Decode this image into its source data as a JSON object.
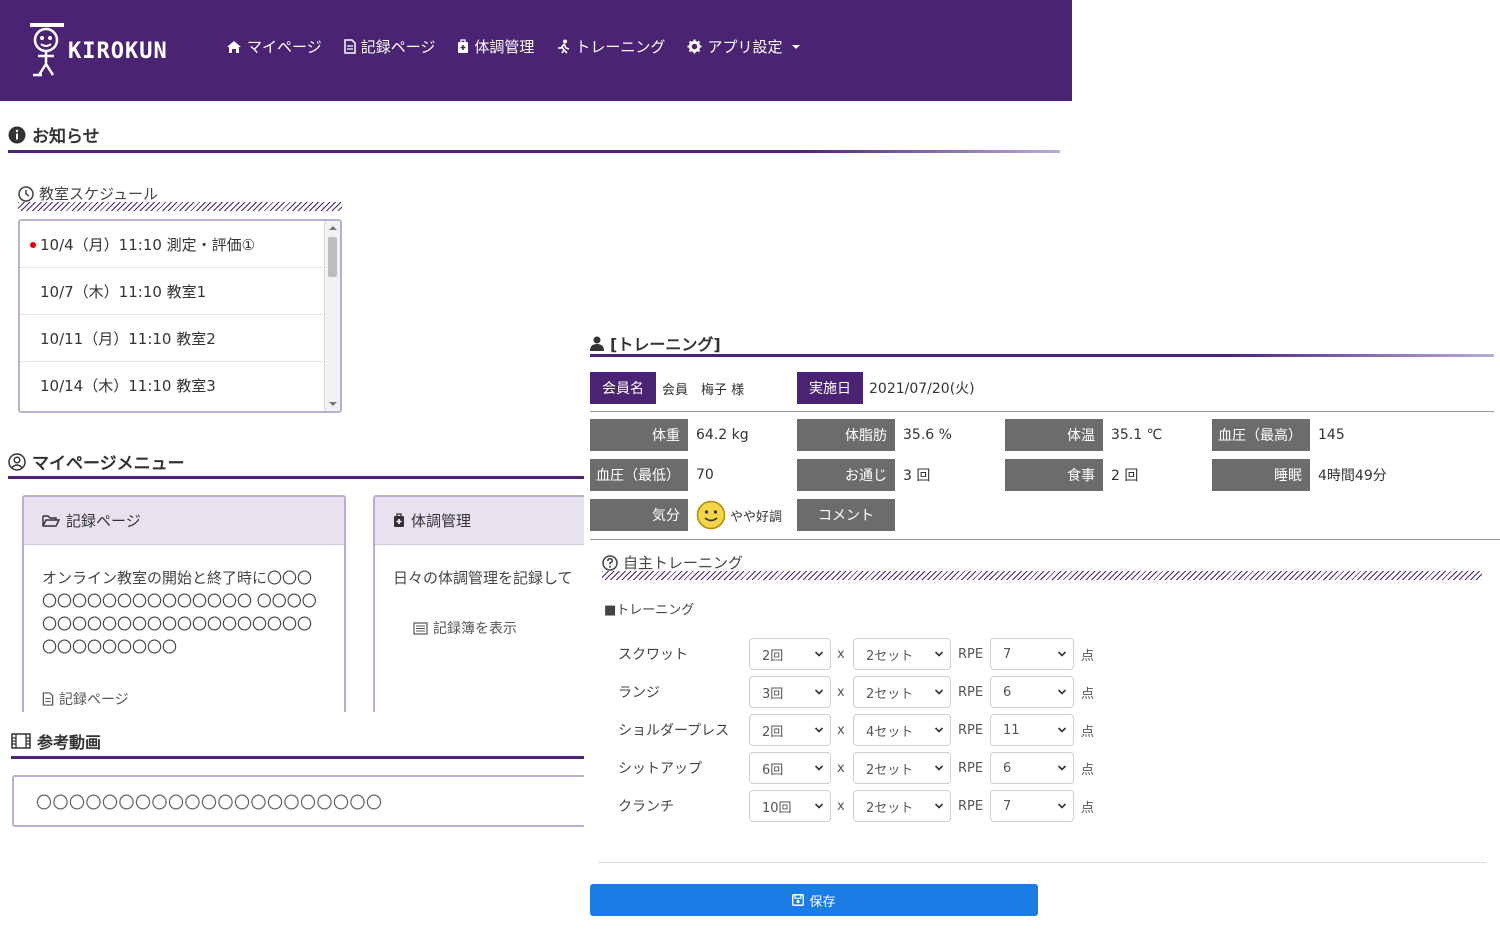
{
  "app": {
    "logo_text": "KIROKUN"
  },
  "nav": {
    "mypage": "マイページ",
    "record": "記録ページ",
    "health": "体調管理",
    "training": "トレーニング",
    "settings": "アプリ設定"
  },
  "notice": {
    "title": "お知らせ"
  },
  "schedule": {
    "title": "教室スケジュール",
    "items": [
      {
        "text": "10/4（月）11:10 測定・評価①",
        "dot": true
      },
      {
        "text": "10/7（木）11:10 教室1"
      },
      {
        "text": "10/11（月）11:10 教室2"
      },
      {
        "text": "10/14（木）11:10 教室3"
      }
    ]
  },
  "mypage_menu": {
    "title": "マイページメニュー",
    "card1": {
      "title": "記録ページ",
      "body": "オンライン教室の開始と終了時に〇〇〇〇〇〇〇〇〇〇〇〇〇〇〇〇〇 〇〇〇〇〇〇〇〇〇〇〇〇〇〇〇〇〇〇〇〇〇〇〇〇〇〇〇〇〇〇〇",
      "link": "記録ページ"
    },
    "card2": {
      "title": "体調管理",
      "body": "日々の体調管理を記録して",
      "link": "記録簿を表示"
    }
  },
  "video": {
    "title": "参考動画",
    "text": "〇〇〇〇〇〇〇〇〇〇〇〇〇〇〇〇〇〇〇〇〇"
  },
  "training": {
    "title": "[トレーニング]",
    "member_label": "会員名",
    "member_value": "会員　梅子 様",
    "date_label": "実施日",
    "date_value": "2021/07/20(火)",
    "metrics": {
      "weight_label": "体重",
      "weight_value": "64.2 kg",
      "fat_label": "体脂肪",
      "fat_value": "35.6 %",
      "temp_label": "体温",
      "temp_value": "35.1 ℃",
      "bp_high_label": "血圧（最高）",
      "bp_high_value": "145",
      "bp_low_label": "血圧（最低）",
      "bp_low_value": "70",
      "bowel_label": "お通じ",
      "bowel_value": "3 回",
      "meal_label": "食事",
      "meal_value": "2 回",
      "sleep_label": "睡眠",
      "sleep_value": "4時間49分",
      "mood_label": "気分",
      "mood_value": "やや好調",
      "comment_label": "コメント"
    },
    "self_title": "自主トレーニング",
    "sub_label": "■トレーニング",
    "x_text": "x",
    "rpe_text": "RPE",
    "unit_text": "点",
    "exercises": [
      {
        "name": "スクワット",
        "reps": "2回",
        "sets": "2セット",
        "rpe": "7"
      },
      {
        "name": "ランジ",
        "reps": "3回",
        "sets": "2セット",
        "rpe": "6"
      },
      {
        "name": "ショルダープレス",
        "reps": "2回",
        "sets": "4セット",
        "rpe": "11"
      },
      {
        "name": "シットアップ",
        "reps": "6回",
        "sets": "2セット",
        "rpe": "6"
      },
      {
        "name": "クランチ",
        "reps": "10回",
        "sets": "2セット",
        "rpe": "7"
      }
    ],
    "save_label": "保存"
  }
}
